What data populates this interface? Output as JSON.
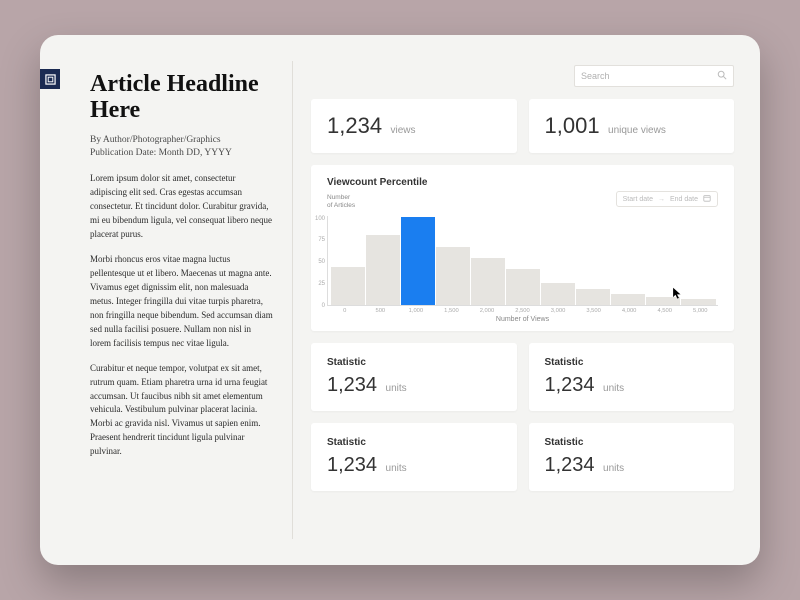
{
  "article": {
    "headline": "Article Headline Here",
    "byline": "By Author/Photographer/Graphics",
    "pubdate": "Publication Date: Month DD, YYYY",
    "para1": "Lorem ipsum dolor sit amet, consectetur adipiscing elit sed. Cras egestas accumsan consectetur. Et tincidunt dolor. Curabitur gravida, mi eu bibendum ligula, vel consequat libero neque placerat purus.",
    "para2": "Morbi rhoncus eros vitae magna luctus pellentesque ut et libero. Maecenas ut magna ante. Vivamus eget dignissim elit, non malesuada metus. Integer fringilla dui vitae turpis pharetra, non fringilla neque bibendum. Sed accumsan diam sed nulla facilisi posuere. Nullam non nisl in lorem facilisis tempus nec vitae ligula.",
    "para3": "Curabitur et neque tempor, volutpat ex sit amet, rutrum quam. Etiam pharetra urna id urna feugiat accumsan. Ut faucibus nibh sit amet elementum vehicula. Vestibulum pulvinar placerat lacinia. Morbi ac gravida nisl. Vivamus ut sapien enim. Praesent hendrerit tincidunt ligula pulvinar pulvinar."
  },
  "search": {
    "placeholder": "Search"
  },
  "top_stats": [
    {
      "value": "1,234",
      "label": "views"
    },
    {
      "value": "1,001",
      "label": "unique views"
    }
  ],
  "chart_data": {
    "type": "bar",
    "title": "Viewcount Percentile",
    "y_axis_label": "Number of Articles",
    "x_axis_label": "Number of Views",
    "categories": [
      "0",
      "500",
      "1,000",
      "1,500",
      "2,000",
      "2,500",
      "3,000",
      "3,500",
      "4,000",
      "4,500",
      "5,000"
    ],
    "values": [
      42,
      78,
      98,
      65,
      52,
      40,
      24,
      18,
      12,
      9,
      6
    ],
    "highlight_index": 2,
    "y_ticks": [
      "100",
      "75",
      "50",
      "25",
      "0"
    ],
    "ylim": [
      0,
      100
    ],
    "date_picker": {
      "start": "Start date",
      "end": "End date"
    }
  },
  "small_stats": [
    {
      "title": "Statistic",
      "value": "1,234",
      "unit": "units"
    },
    {
      "title": "Statistic",
      "value": "1,234",
      "unit": "units"
    },
    {
      "title": "Statistic",
      "value": "1,234",
      "unit": "units"
    },
    {
      "title": "Statistic",
      "value": "1,234",
      "unit": "units"
    }
  ]
}
